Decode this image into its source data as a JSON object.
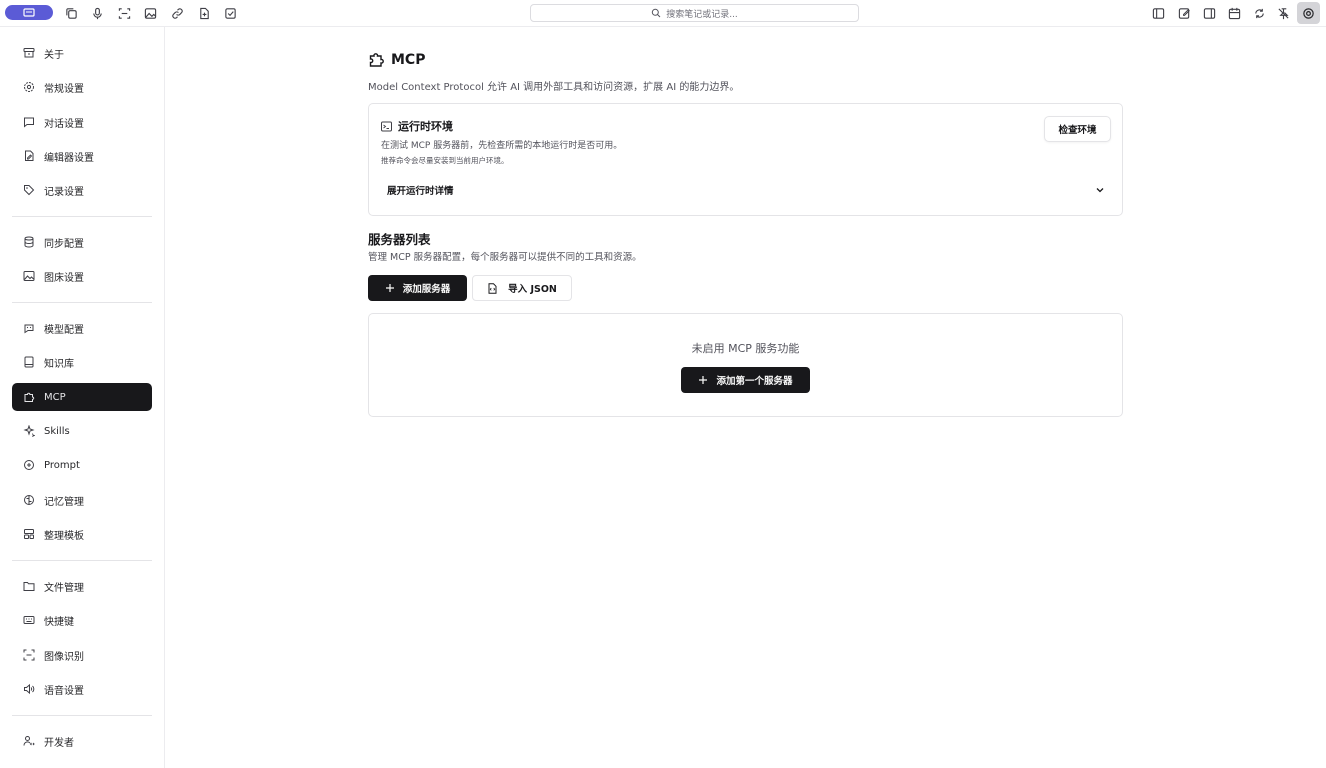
{
  "topbar": {
    "search_placeholder": "搜索笔记或记录...",
    "accent_color": "#5b5bd6",
    "left_icons": [
      "copy-icon",
      "mic-icon",
      "scan-icon",
      "image-icon",
      "link-icon",
      "file-plus-icon",
      "checkbox-icon"
    ],
    "right_icons": [
      "sidebar-left-icon",
      "edit-icon",
      "panel-icon",
      "calendar-icon",
      "sync-icon",
      "pin-off-icon",
      "settings-icon"
    ]
  },
  "sidebar": {
    "items": [
      {
        "label": "关于",
        "icon": "archive-icon"
      },
      {
        "label": "常规设置",
        "icon": "settings-icon"
      },
      {
        "label": "对话设置",
        "icon": "chat-icon"
      },
      {
        "label": "编辑器设置",
        "icon": "file-edit-icon"
      },
      {
        "label": "记录设置",
        "icon": "tag-icon"
      },
      {
        "label": "同步配置",
        "icon": "database-icon"
      },
      {
        "label": "图床设置",
        "icon": "image-icon"
      },
      {
        "label": "模型配置",
        "icon": "bot-icon"
      },
      {
        "label": "知识库",
        "icon": "book-icon"
      },
      {
        "label": "MCP",
        "icon": "puzzle-icon"
      },
      {
        "label": "Skills",
        "icon": "sparkles-icon"
      },
      {
        "label": "Prompt",
        "icon": "message-icon"
      },
      {
        "label": "记忆管理",
        "icon": "brain-icon"
      },
      {
        "label": "整理模板",
        "icon": "layout-icon"
      },
      {
        "label": "文件管理",
        "icon": "folder-icon"
      },
      {
        "label": "快捷键",
        "icon": "keyboard-icon"
      },
      {
        "label": "图像识别",
        "icon": "scan-icon"
      },
      {
        "label": "语音设置",
        "icon": "speaker-icon"
      },
      {
        "label": "开发者",
        "icon": "user-code-icon"
      }
    ]
  },
  "main": {
    "title": "MCP",
    "description": "Model Context Protocol 允许 AI 调用外部工具和访问资源，扩展 AI 的能力边界。",
    "runtime": {
      "title": "运行时环境",
      "description": "在测试 MCP 服务器前，先检查所需的本地运行时是否可用。",
      "hint": "推荐命令会尽量安装到当前用户环境。",
      "check_button": "检查环境",
      "expand_label": "展开运行时详情"
    },
    "servers": {
      "title": "服务器列表",
      "description": "管理 MCP 服务器配置，每个服务器可以提供不同的工具和资源。",
      "add_button": "添加服务器",
      "import_button": "导入 JSON",
      "empty_text": "未启用 MCP 服务功能",
      "add_first_button": "添加第一个服务器"
    }
  }
}
